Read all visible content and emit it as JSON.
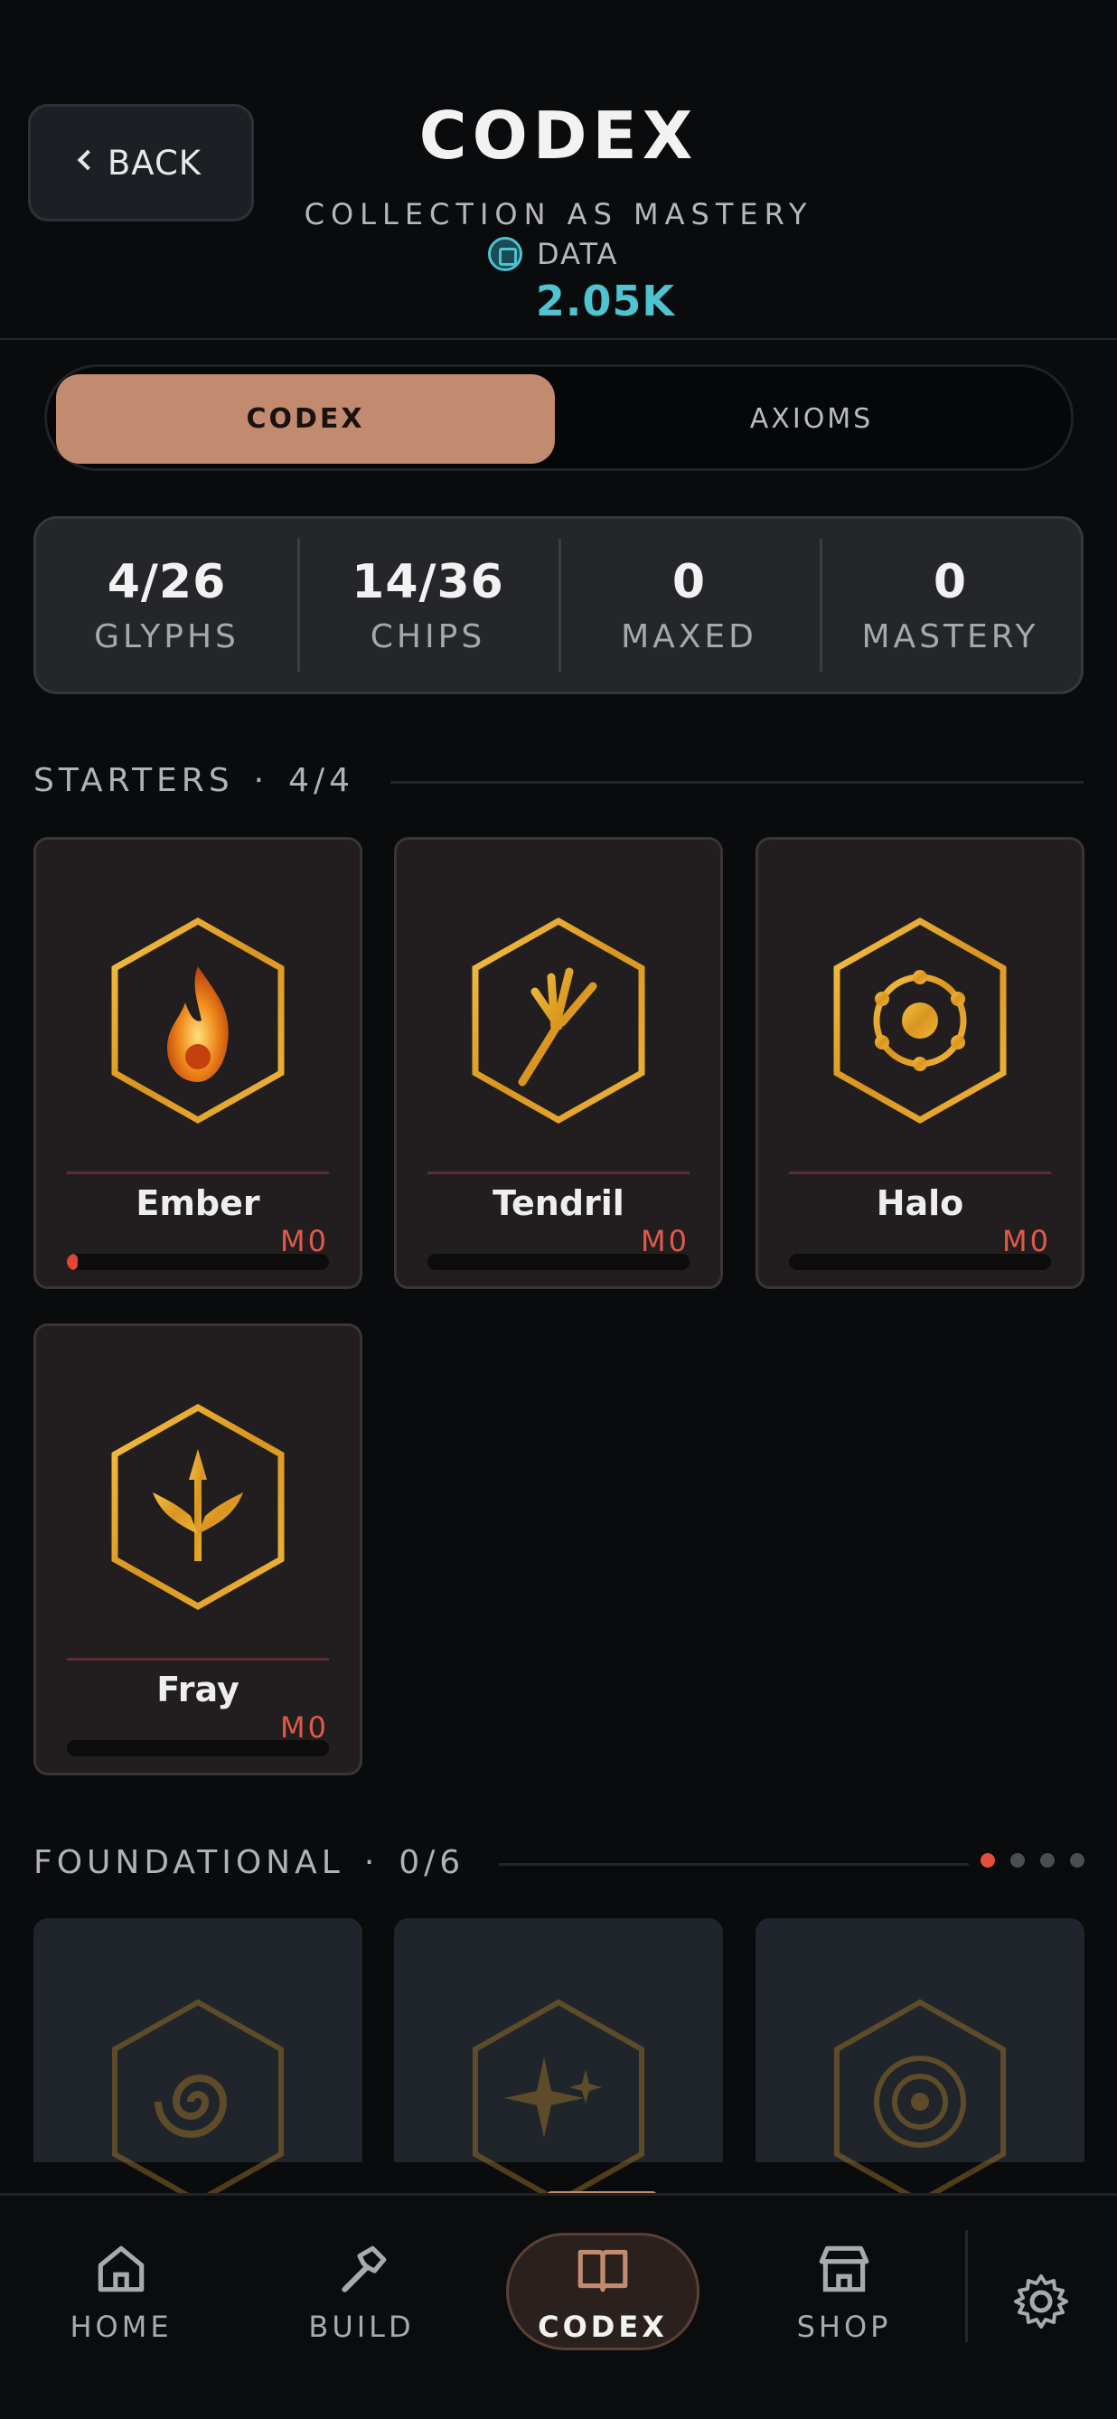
{
  "header": {
    "back_label": "BACK",
    "title": "CODEX",
    "subtitle": "COLLECTION AS MASTERY",
    "currency_label": "DATA",
    "currency_value": "2.05K"
  },
  "tabs": [
    {
      "label": "CODEX",
      "active": true
    },
    {
      "label": "AXIOMS",
      "active": false
    }
  ],
  "stats": [
    {
      "value": "4/26",
      "label": "GLYPHS"
    },
    {
      "value": "14/36",
      "label": "CHIPS"
    },
    {
      "value": "0",
      "label": "MAXED"
    },
    {
      "value": "0",
      "label": "MASTERY"
    }
  ],
  "starters": {
    "title": "STARTERS",
    "count": "4/4",
    "cards": [
      {
        "name": "Ember",
        "level": "M0",
        "icon": "flame-icon",
        "progress": 0.04
      },
      {
        "name": "Tendril",
        "level": "M0",
        "icon": "tendril-icon",
        "progress": 0
      },
      {
        "name": "Halo",
        "level": "M0",
        "icon": "halo-icon",
        "progress": 0
      },
      {
        "name": "Fray",
        "level": "M0",
        "icon": "trident-icon",
        "progress": 0
      }
    ]
  },
  "foundational": {
    "title": "FOUNDATIONAL",
    "count": "0/6",
    "page_dots": 4,
    "active_dot": 0,
    "cards": [
      {
        "icon": "vortex-icon"
      },
      {
        "icon": "sparkle-icon"
      },
      {
        "icon": "target-icon"
      }
    ]
  },
  "nav": [
    {
      "label": "HOME",
      "icon": "home-icon",
      "active": false
    },
    {
      "label": "BUILD",
      "icon": "hammer-icon",
      "active": false
    },
    {
      "label": "CODEX",
      "icon": "book-icon",
      "active": true
    },
    {
      "label": "SHOP",
      "icon": "store-icon",
      "active": false
    },
    {
      "label": "",
      "icon": "gear-icon",
      "active": false
    }
  ],
  "colors": {
    "accent": "#c28a6e",
    "currency": "#4fc3cf",
    "mastery": "#e05a4a",
    "gold": "#e0a52a"
  }
}
